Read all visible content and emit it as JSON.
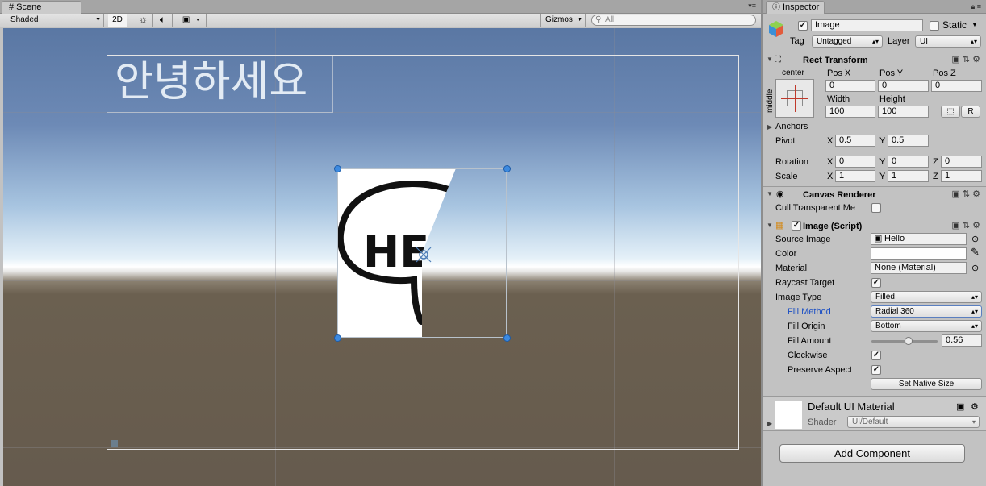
{
  "scene": {
    "tab_label": "Scene",
    "shading_mode": "Shaded",
    "mode_2d": "2D",
    "gizmos_label": "Gizmos",
    "search_placeholder": "All",
    "canvas_text": "안녕하세요"
  },
  "inspector": {
    "tab_label": "Inspector",
    "object_name": "Image",
    "static_label": "Static",
    "tag_label": "Tag",
    "tag_value": "Untagged",
    "layer_label": "Layer",
    "layer_value": "UI",
    "rect_transform": {
      "title": "Rect Transform",
      "anchor_h": "center",
      "anchor_v": "middle",
      "pos_x_label": "Pos X",
      "pos_x": "0",
      "pos_y_label": "Pos Y",
      "pos_y": "0",
      "pos_z_label": "Pos Z",
      "pos_z": "0",
      "width_label": "Width",
      "width": "100",
      "height_label": "Height",
      "height": "100",
      "r_button": "R",
      "anchors_label": "Anchors",
      "pivot_label": "Pivot",
      "pivot_x": "0.5",
      "pivot_y": "0.5",
      "rotation_label": "Rotation",
      "rot_x": "0",
      "rot_y": "0",
      "rot_z": "0",
      "scale_label": "Scale",
      "scale_x": "1",
      "scale_y": "1",
      "scale_z": "1",
      "x_label": "X",
      "y_label": "Y",
      "z_label": "Z"
    },
    "canvas_renderer": {
      "title": "Canvas Renderer",
      "cull_label": "Cull Transparent Me"
    },
    "image_script": {
      "title": "Image (Script)",
      "source_image_label": "Source Image",
      "source_image": "Hello",
      "color_label": "Color",
      "color_value": "#ffffff",
      "material_label": "Material",
      "material": "None (Material)",
      "raycast_label": "Raycast Target",
      "image_type_label": "Image Type",
      "image_type": "Filled",
      "fill_method_label": "Fill Method",
      "fill_method": "Radial 360",
      "fill_origin_label": "Fill Origin",
      "fill_origin": "Bottom",
      "fill_amount_label": "Fill Amount",
      "fill_amount": "0.56",
      "clockwise_label": "Clockwise",
      "preserve_aspect_label": "Preserve Aspect",
      "set_native_size": "Set Native Size"
    },
    "material_preview": {
      "name": "Default UI Material",
      "shader_label": "Shader",
      "shader_value": "UI/Default"
    },
    "add_component": "Add Component"
  },
  "preview_image": {
    "text": "HEL"
  }
}
